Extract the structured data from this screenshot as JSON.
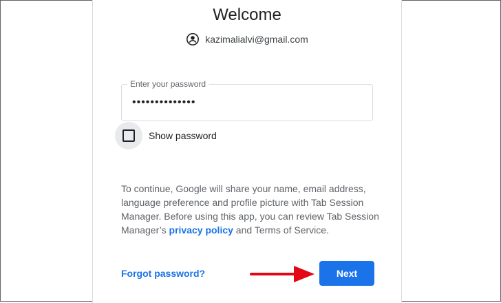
{
  "header": {
    "title": "Welcome",
    "account_email": "kazimalialvi@gmail.com",
    "account_icon": "account-circle-icon"
  },
  "password_field": {
    "label": "Enter your password",
    "masked_value": "••••••••••••••"
  },
  "show_password": {
    "label": "Show password",
    "checked": false
  },
  "consent": {
    "text_before_link": "To continue, Google will share your name, email address, language preference and profile picture with Tab Session Manager. Before using this app, you can review Tab Session Manager’s ",
    "privacy_link": "privacy policy",
    "text_after_link": " and Terms of Service."
  },
  "footer": {
    "forgot_label": "Forgot password?",
    "next_label": "Next"
  },
  "colors": {
    "accent": "#1a73e8",
    "arrow": "#e30613",
    "text": "#202124",
    "muted": "#5f6368"
  }
}
